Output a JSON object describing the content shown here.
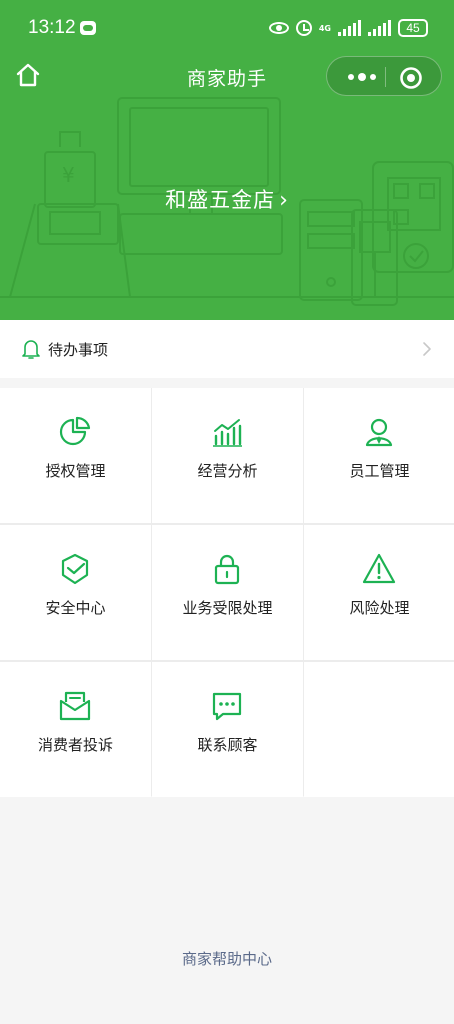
{
  "status_bar": {
    "time": "13:12",
    "network": "4G",
    "battery": "45",
    "icons": [
      "wechat-icon",
      "eye-icon",
      "alarm-icon",
      "signal-icon",
      "signal-icon",
      "battery-icon"
    ]
  },
  "nav": {
    "title": "商家助手",
    "home_icon": "home-icon",
    "menu_icon": "more-dots-icon",
    "close_icon": "target-icon"
  },
  "header": {
    "shop_name": "和盛五金店",
    "chevron": "›",
    "background_color": "#45b044"
  },
  "todo": {
    "label": "待办事项",
    "icon": "bell-icon"
  },
  "grid": {
    "items": [
      {
        "label": "授权管理",
        "icon": "pie-chart-icon"
      },
      {
        "label": "经营分析",
        "icon": "bar-chart-icon"
      },
      {
        "label": "员工管理",
        "icon": "staff-icon"
      },
      {
        "label": "安全中心",
        "icon": "shield-icon"
      },
      {
        "label": "业务受限处理",
        "icon": "lock-icon"
      },
      {
        "label": "风险处理",
        "icon": "warning-icon"
      },
      {
        "label": "消费者投诉",
        "icon": "envelope-icon"
      },
      {
        "label": "联系顾客",
        "icon": "chat-icon"
      }
    ]
  },
  "footer": {
    "help_link": "商家帮助中心"
  },
  "colors": {
    "accent": "#45b044",
    "icon_green": "#1db253",
    "link": "#5b6a8a"
  }
}
